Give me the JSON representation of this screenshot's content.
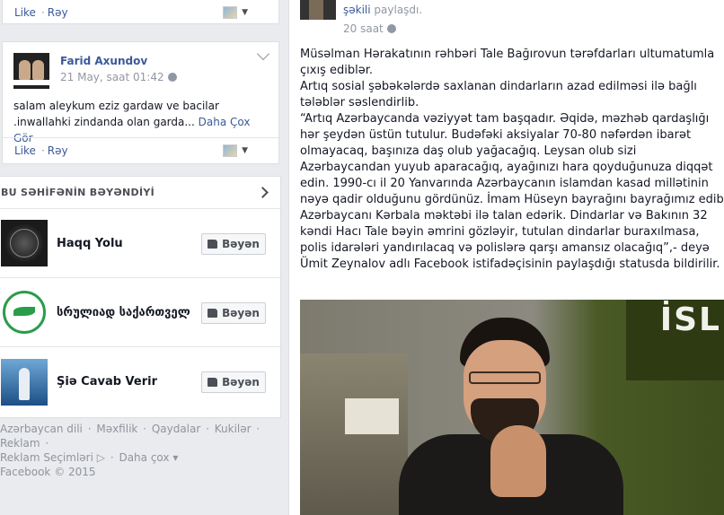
{
  "top_actions": {
    "like": "Like",
    "reply": "Rəy",
    "separator": "·"
  },
  "comment": {
    "author": "Farid Axundov",
    "time": "21 May, saat 01:42",
    "text": "salam aleykum eziz gardaw ve bacilar .inwallahki zindanda olan garda...",
    "more": "Daha Çox Gör",
    "like": "Like",
    "reply": "Rəy"
  },
  "likes": {
    "title": "BU SƏHİFƏNİN BƏYƏNDİYİ",
    "button_label": "Bəyən",
    "pages": [
      {
        "name": "Haqq Yolu"
      },
      {
        "name": "სრულიად საქართველ..."
      },
      {
        "name": "Şiə Cavab Verir"
      }
    ]
  },
  "footer": {
    "links": [
      "Azərbaycan dili",
      "Məxfilik",
      "Qaydalar",
      "Kukilər",
      "Reklam",
      "Reklam Seçimləri",
      "Daha çox"
    ],
    "copyright": "Facebook © 2015"
  },
  "post": {
    "header_link": "şəkili",
    "header_text": "paylaşdı.",
    "time": "20 saat",
    "paragraphs": [
      "Müsəlman Hərakatının rəhbəri Tale Bağırovun tərəfdarları ultumatumla çıxış ediblər.",
      "Artıq sosial şəbəkələrdə saxlanan dindarların azad edilməsi ilə bağlı tələblər səslendirlib.",
      "“Artıq Azərbaycanda vəziyyət tam başqadır. Əqidə, məzhəb qardaşlığı hər şeydən üstün tutulur. Budəfəki aksiyalar 70-80 nəfərdən ibarət olmayacaq, başınıza daş olub yağacağıq. Leysan olub sizi Azərbaycandan yuyub aparacağıq, ayağınızı hara qoyduğunuza diqqət edin. 1990-cı il 20 Yanvarında Azərbaycanın islamdan kasad millətinin nəyə qadir olduğunu gördünüz. İmam Hüseyn bayrağını bayrağımız edib Azərbaycanı Kərbala məktəbi ilə talan edərik. Dindarlar və Bakının 32 kəndi Hacı Tale bəyin əmrini gözləyir, tutulan dindarlar buraxılmasa, polis idarələri yandırılacaq və polislərə qarşı amansız olacağıq”,- deyə Ümit Zeynalov adlı Facebook istifadəçisinin paylaşdığı statusda bildirilir."
    ],
    "photo_banner": "İSL"
  }
}
